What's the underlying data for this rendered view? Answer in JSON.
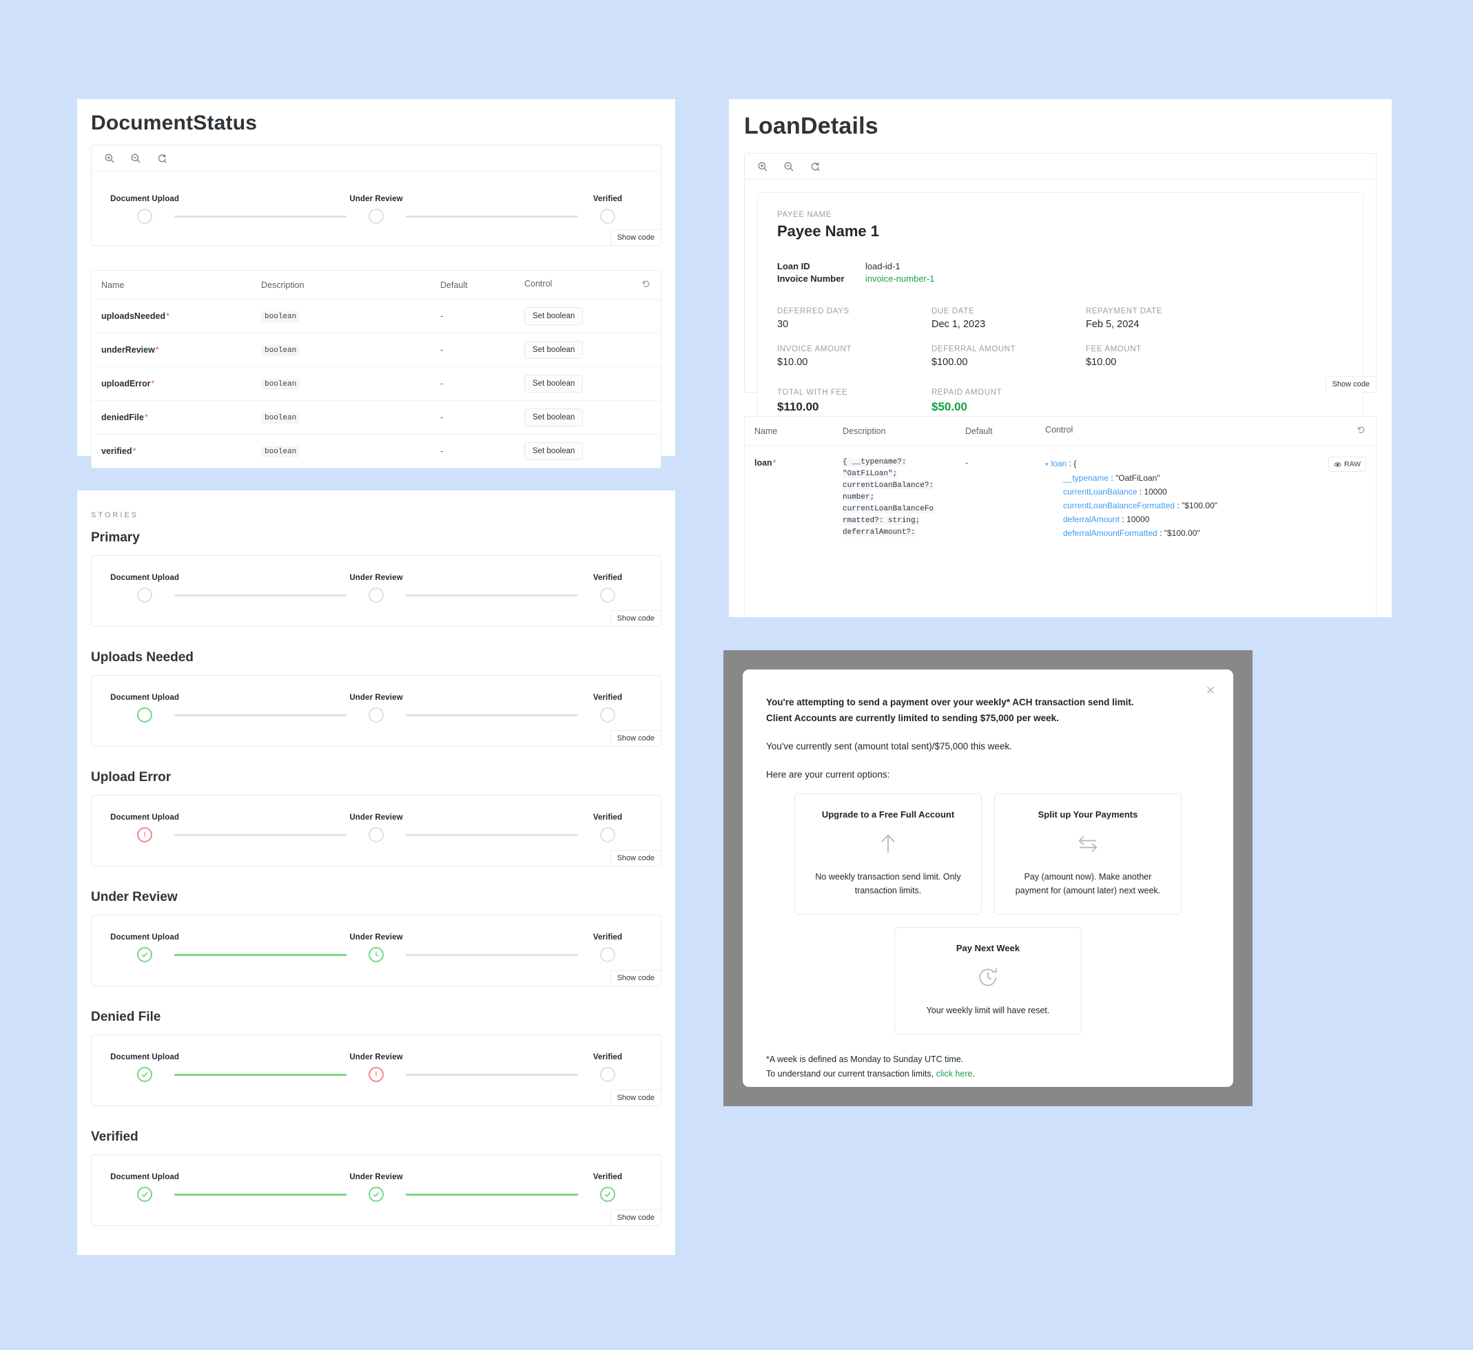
{
  "background_color": "#cfe0fb",
  "accent_green": "#74d97f",
  "accent_red": "#f4868d",
  "panels": {
    "document_status": {
      "title": "DocumentStatus",
      "zoom_controls": [
        "zoom-in-icon",
        "zoom-out-icon",
        "zoom-reset-icon"
      ],
      "show_code_label": "Show code",
      "stepper_labels": [
        "Document Upload",
        "Under Review",
        "Verified"
      ],
      "props_table": {
        "headers": [
          "Name",
          "Description",
          "Default",
          "Control"
        ],
        "reset_icon": "reset-icon",
        "rows": [
          {
            "name": "uploadsNeeded",
            "required": "*",
            "description": "boolean",
            "default": "-",
            "control": "Set boolean"
          },
          {
            "name": "underReview",
            "required": "*",
            "description": "boolean",
            "default": "-",
            "control": "Set boolean"
          },
          {
            "name": "uploadError",
            "required": "*",
            "description": "boolean",
            "default": "-",
            "control": "Set boolean"
          },
          {
            "name": "deniedFile",
            "required": "*",
            "description": "boolean",
            "default": "-",
            "control": "Set boolean"
          },
          {
            "name": "verified",
            "required": "*",
            "description": "boolean",
            "default": "-",
            "control": "Set boolean"
          }
        ]
      }
    },
    "stories": {
      "eyebrow": "STORIES",
      "show_code_label": "Show code",
      "stepper_labels": [
        "Document Upload",
        "Under Review",
        "Verified"
      ],
      "items": [
        {
          "heading": "Primary",
          "states": [
            "empty",
            "empty",
            "empty"
          ],
          "connectors": [
            "grey",
            "grey"
          ]
        },
        {
          "heading": "Uploads Needed",
          "states": [
            "active",
            "empty",
            "empty"
          ],
          "connectors": [
            "grey",
            "grey"
          ]
        },
        {
          "heading": "Upload Error",
          "states": [
            "error",
            "empty",
            "empty"
          ],
          "connectors": [
            "grey",
            "grey"
          ]
        },
        {
          "heading": "Under Review",
          "states": [
            "done",
            "pending",
            "empty"
          ],
          "connectors": [
            "green",
            "grey"
          ]
        },
        {
          "heading": "Denied File",
          "states": [
            "done",
            "error",
            "empty"
          ],
          "connectors": [
            "green",
            "grey"
          ]
        },
        {
          "heading": "Verified",
          "states": [
            "done",
            "done",
            "done"
          ],
          "connectors": [
            "green",
            "green"
          ]
        }
      ]
    },
    "loan_details": {
      "title": "LoanDetails",
      "zoom_controls": [
        "zoom-in-icon",
        "zoom-out-icon",
        "zoom-reset-icon"
      ],
      "show_code_label": "Show code",
      "card": {
        "payee_eyebrow": "PAYEE NAME",
        "payee_name": "Payee Name 1",
        "loan_id_label": "Loan ID",
        "loan_id_value": "load-id-1",
        "invoice_number_label": "Invoice Number",
        "invoice_number_value": "invoice-number-1",
        "metrics": [
          {
            "label": "DEFERRED DAYS",
            "value": "30"
          },
          {
            "label": "DUE DATE",
            "value": "Dec 1, 2023"
          },
          {
            "label": "REPAYMENT DATE",
            "value": "Feb 5, 2024"
          },
          {
            "label": "INVOICE AMOUNT",
            "value": "$10.00"
          },
          {
            "label": "DEFERRAL AMOUNT",
            "value": "$100.00"
          },
          {
            "label": "FEE AMOUNT",
            "value": "$10.00"
          },
          {
            "label": "TOTAL WITH FEE",
            "value": "$110.00"
          },
          {
            "label": "REPAID AMOUNT",
            "value": "$50.00"
          }
        ]
      },
      "props_table": {
        "headers": [
          "Name",
          "Description",
          "Default",
          "Control"
        ],
        "reset_icon": "reset-icon",
        "row": {
          "name": "loan",
          "required": "*",
          "description_lines": [
            "{ __typename?:",
            "\"OatFiLoan\";",
            "currentLoanBalance?:",
            "number;",
            "currentLoanBalanceFo",
            "rmatted?: string;",
            "deferralAmount?:"
          ],
          "default": "-",
          "raw_button": "RAW",
          "json_root": "loan",
          "json_entries": [
            {
              "key": "__typename",
              "value": "\"OatFiLoan\""
            },
            {
              "key": "currentLoanBalance",
              "value": "10000"
            },
            {
              "key": "currentLoanBalanceFormatted",
              "value": "\"$100.00\""
            },
            {
              "key": "deferralAmount",
              "value": "10000"
            },
            {
              "key": "deferralAmountFormatted",
              "value": "\"$100.00\""
            }
          ]
        }
      }
    },
    "limit_modal": {
      "close_icon": "close-icon",
      "headline_line1": "You're attempting to send a payment over your weekly* ACH transaction send limit.",
      "headline_line2": "Client Accounts are currently limited to sending $75,000 per week.",
      "sent_text": "You've currently sent (amount total sent)/$75,000 this week.",
      "options_intro": "Here are your current options:",
      "options": [
        {
          "title": "Upgrade to a Free Full Account",
          "icon": "arrow-up-icon",
          "description": "No weekly transaction send limit. Only transaction limits."
        },
        {
          "title": "Split up Your Payments",
          "icon": "swap-arrows-icon",
          "description": "Pay (amount now). Make another payment for (amount later) next week."
        }
      ],
      "option_center": {
        "title": "Pay Next Week",
        "icon": "clock-reset-icon",
        "description": "Your weekly limit will have reset."
      },
      "footnote_line1": "*A week is defined as Monday to Sunday UTC time.",
      "footnote_line2_prefix": "To understand our current transaction limits, ",
      "footnote_link": "click here",
      "footnote_line2_suffix": "."
    }
  }
}
